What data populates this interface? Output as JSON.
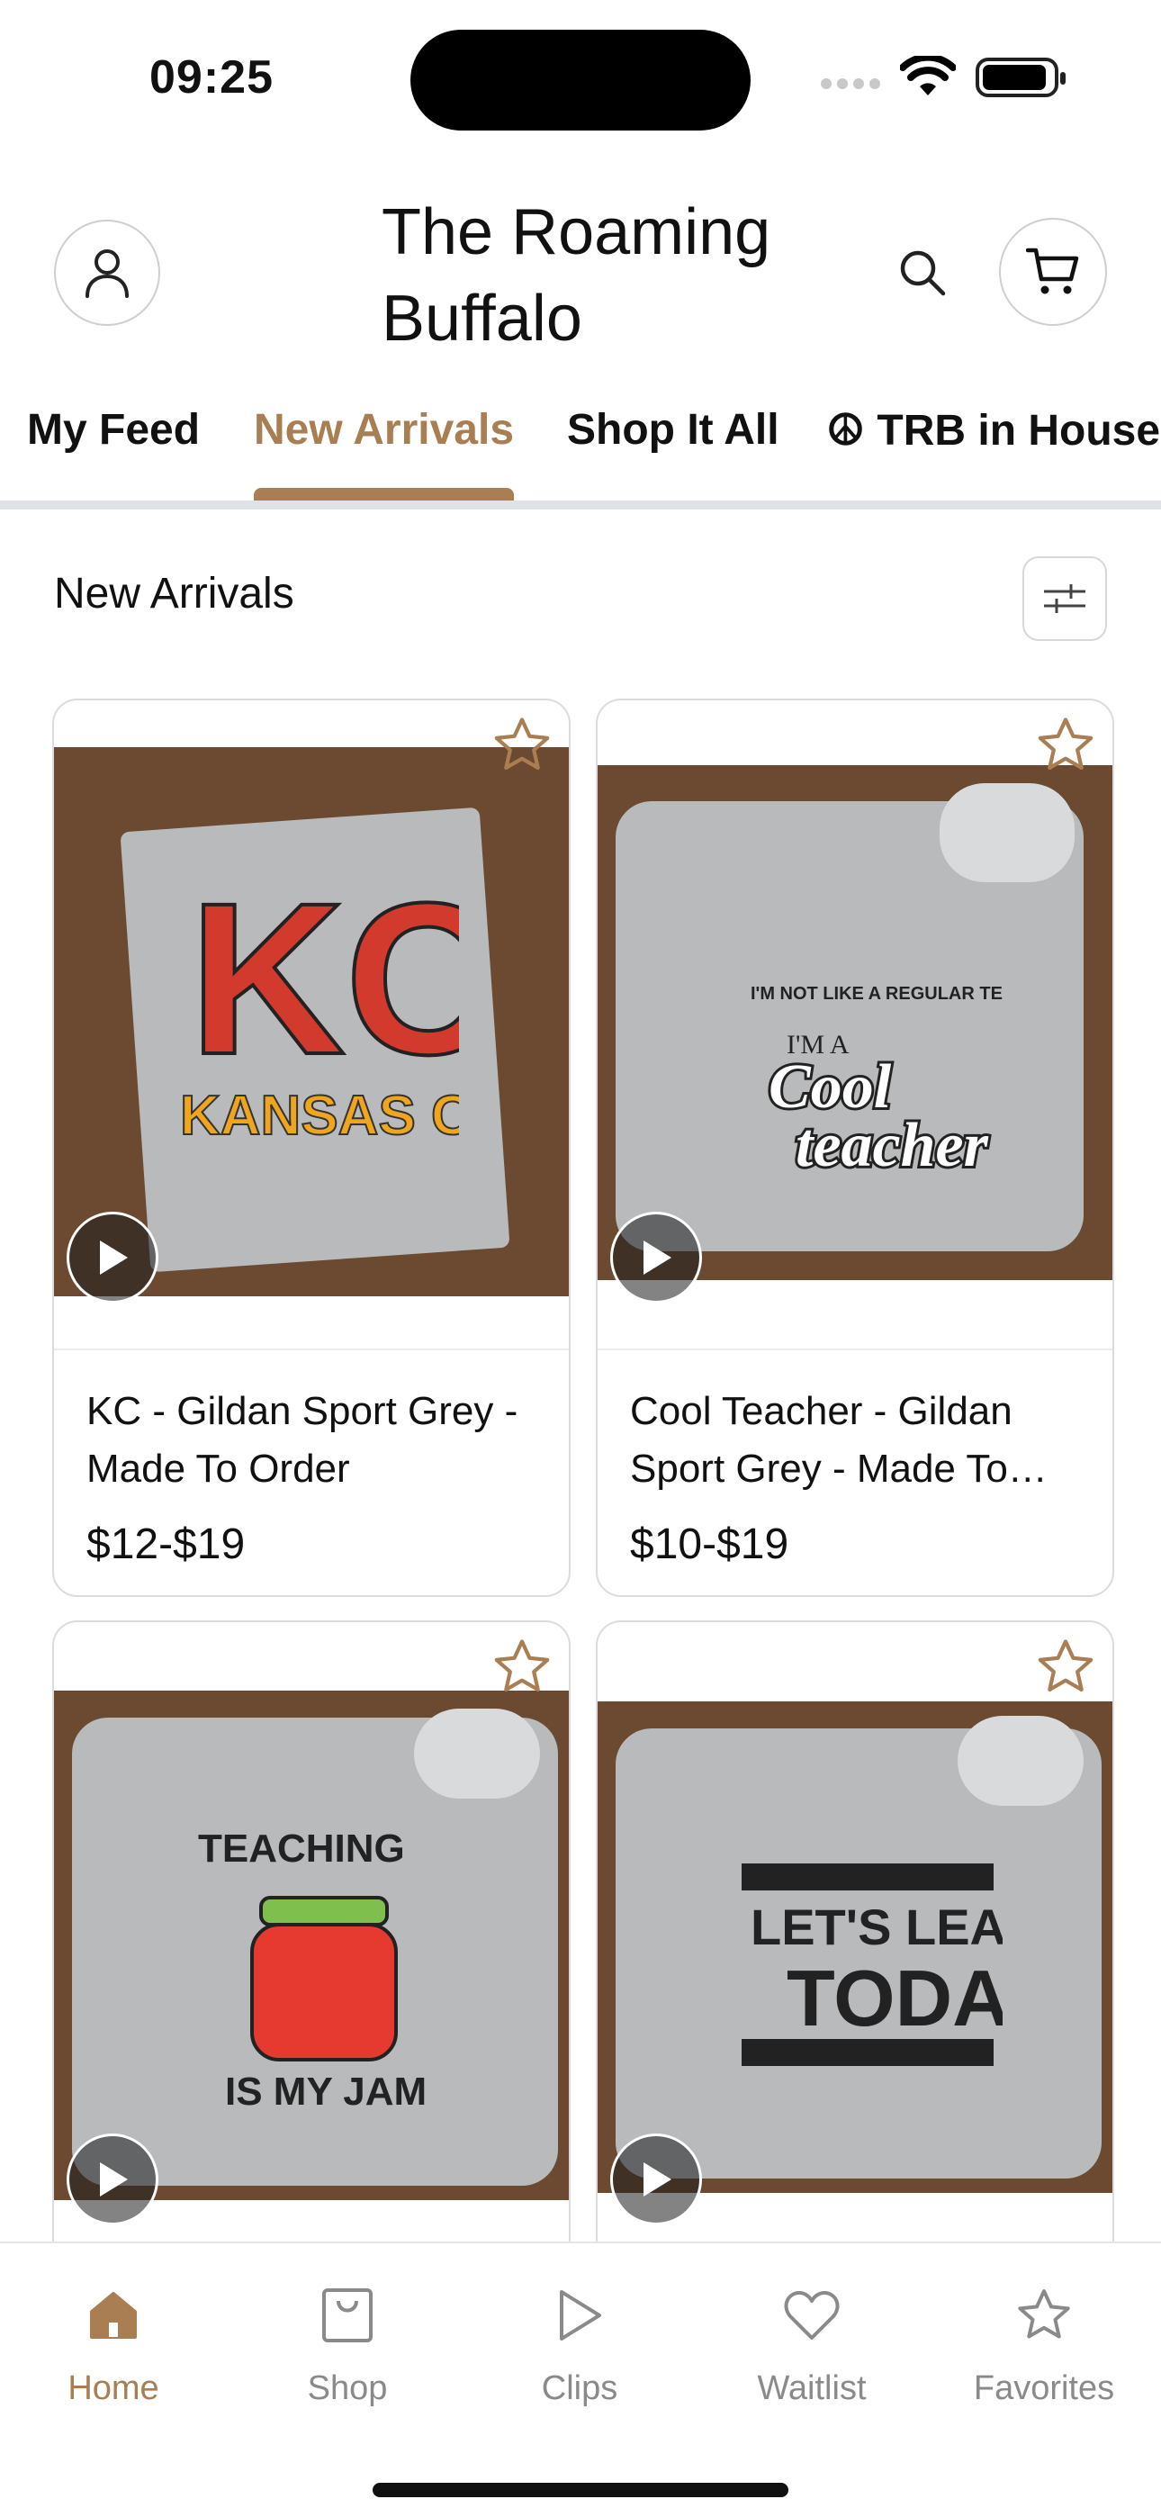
{
  "status_bar": {
    "time": "09:25"
  },
  "header": {
    "title": "The Roaming Buffalo"
  },
  "tabs": [
    {
      "label": "My Feed",
      "active": false
    },
    {
      "label": "New Arrivals",
      "active": true
    },
    {
      "label": "Shop It All",
      "active": false
    },
    {
      "label": "☮ TRB in House S",
      "active": false
    }
  ],
  "section": {
    "title": "New Arrivals"
  },
  "products": [
    {
      "name": "KC - Gildan Sport Grey - Made To Order",
      "price": "$12-$19",
      "graphic": "KC KANSAS CITY"
    },
    {
      "name": "Cool Teacher - Gildan Sport Grey - Made To…",
      "price": "$10-$19",
      "graphic": "I'M NOT LIKE A REGULAR TEACHER I'M A Cool teacher"
    },
    {
      "name": "",
      "price": "",
      "graphic": "TEACHING IS MY JAM"
    },
    {
      "name": "",
      "price": "",
      "graphic": "LET'S LEARN TODAY"
    }
  ],
  "tabbar": [
    {
      "label": "Home",
      "icon": "home-icon",
      "active": true
    },
    {
      "label": "Shop",
      "icon": "shopping-bag-icon",
      "active": false
    },
    {
      "label": "Clips",
      "icon": "play-icon",
      "active": false
    },
    {
      "label": "Waitlist",
      "icon": "heart-icon",
      "active": false
    },
    {
      "label": "Favorites",
      "icon": "star-icon",
      "active": false
    }
  ],
  "colors": {
    "accent": "#a97e52",
    "divider": "#dfe2e6"
  }
}
